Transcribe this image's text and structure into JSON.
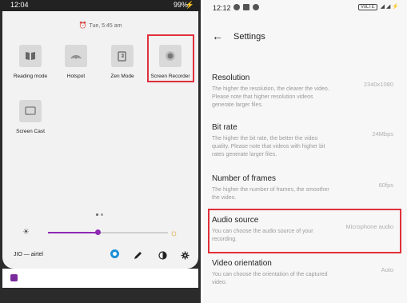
{
  "left_phone": {
    "status_bar": {
      "time": "12:04",
      "battery": "99%"
    },
    "alarm_text": "Tue, 5:45 am",
    "tiles": [
      {
        "label": "Reading mode",
        "icon": "book-icon"
      },
      {
        "label": "Hotspot",
        "icon": "hotspot-icon"
      },
      {
        "label": "Zen Mode",
        "icon": "zen-mode-icon"
      },
      {
        "label": "Screen Recorder",
        "icon": "record-icon"
      },
      {
        "label": "Screen Cast",
        "icon": "cast-icon"
      }
    ],
    "highlight_color": "#e0303a",
    "brightness": {
      "level": 0.41,
      "accent": "#8c2ab4"
    },
    "carrier": "JIO — airtel",
    "quick_icons": [
      "user-avatar-icon",
      "edit-pencil-icon",
      "dark-mode-icon",
      "settings-gear-icon"
    ]
  },
  "right_phone": {
    "status_bar": {
      "time": "12:12",
      "network": "VoLTE"
    },
    "header": {
      "title": "Settings"
    },
    "settings": [
      {
        "title": "Resolution",
        "desc": "The higher the resolution, the clearer the video. Please note that higher resolution videos generate larger files.",
        "value": "2340x1080"
      },
      {
        "title": "Bit rate",
        "desc": "The higher the bit rate, the better the video quality. Please note that videos with higher bit rates generate larger files.",
        "value": "24Mbps"
      },
      {
        "title": "Number of frames",
        "desc": "The higher the number of frames, the smoother the video.",
        "value": "60fps"
      },
      {
        "title": "Audio source",
        "desc": "You can choose the audio source of your recording.",
        "value": "Microphone audio"
      },
      {
        "title": "Video orientation",
        "desc": "You can choose the orientation of the captured video.",
        "value": "Auto"
      }
    ],
    "highlight_color": "#e0303a"
  }
}
